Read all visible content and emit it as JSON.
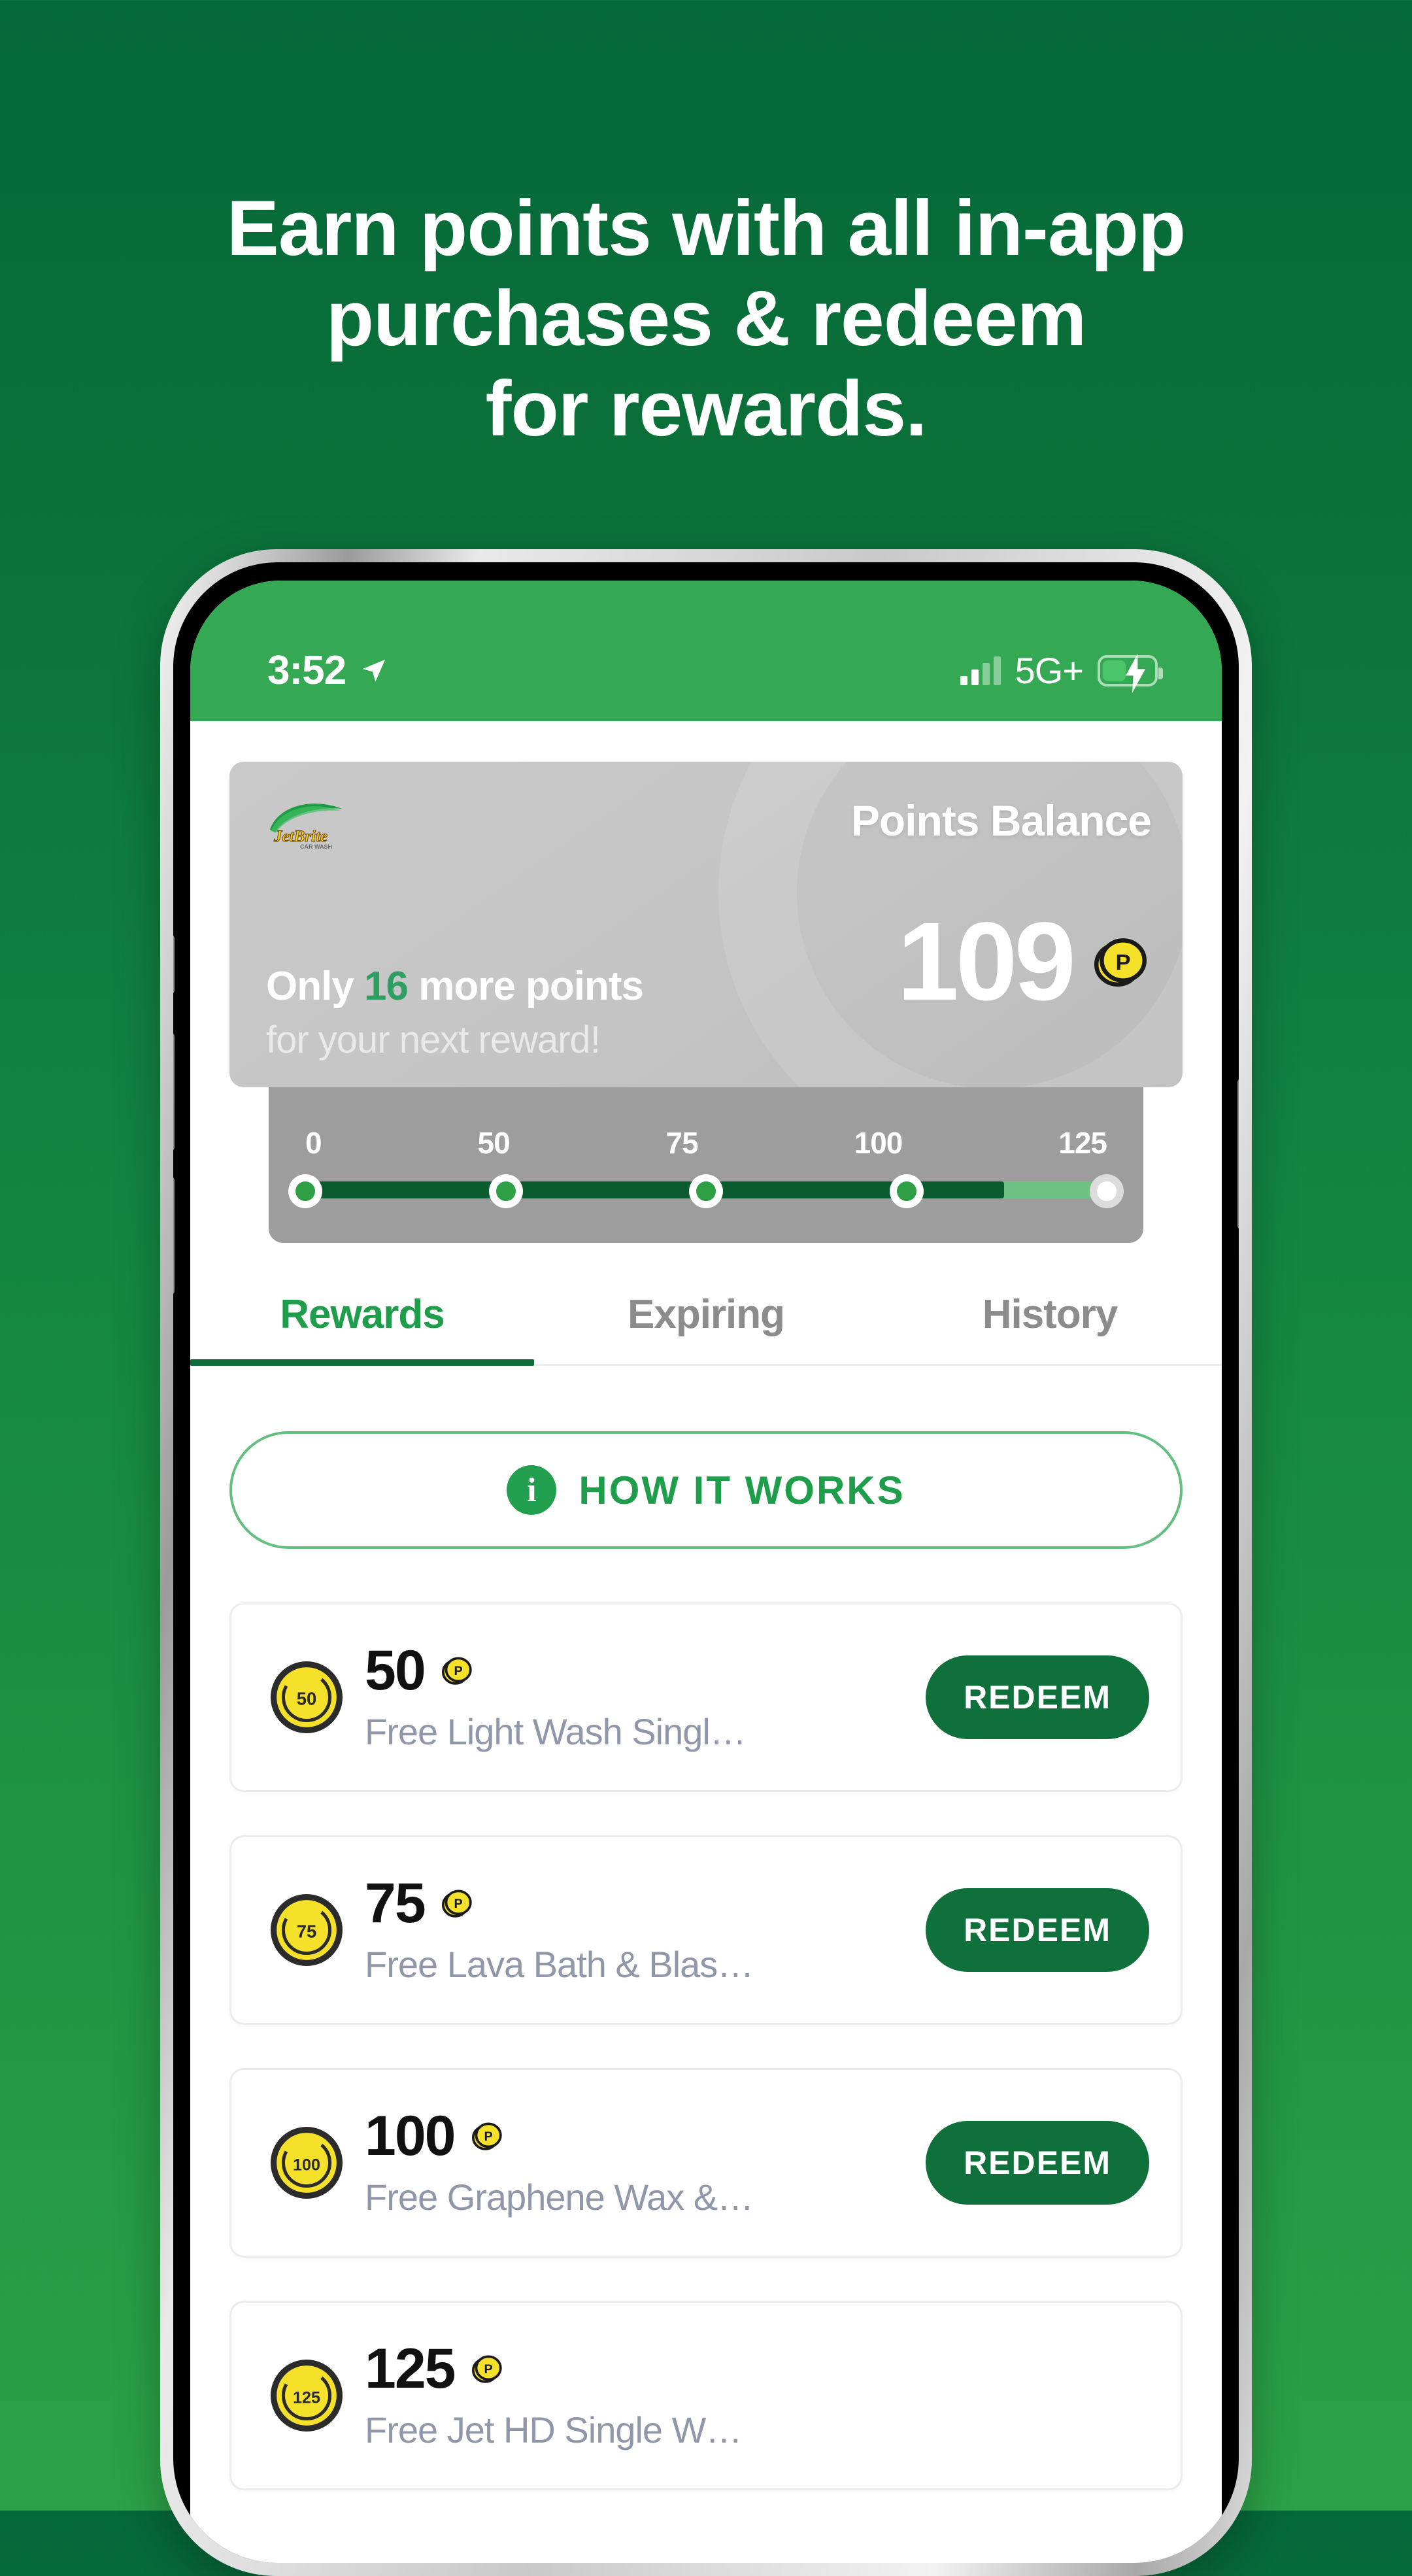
{
  "headline": {
    "line1": "Earn points with all in-app",
    "line2": "purchases & redeem",
    "line3": "for rewards."
  },
  "status_bar": {
    "time": "3:52",
    "location_icon": "location-arrow-icon",
    "signal_icon": "signal-bars-icon",
    "network": "5G+",
    "battery_icon": "battery-charging-icon"
  },
  "points_card": {
    "brand_logo": "jetbrite-car-wash-logo",
    "brand_name": "JetBrite",
    "brand_sub": "CAR WASH",
    "balance_label": "Points Balance",
    "balance_value": "109",
    "coin_icon": "points-coin-icon",
    "only_prefix": "Only ",
    "only_points": "16",
    "only_suffix": " more points",
    "next_reward_line": "for your next reward!",
    "accent_color": "#2E9E63"
  },
  "progress": {
    "ticks": [
      "0",
      "50",
      "75",
      "100",
      "125"
    ],
    "min": 0,
    "max": 125,
    "current": 109,
    "fill_color": "#0A5C2E",
    "remaining_color": "#6FC083"
  },
  "tabs": [
    {
      "label": "Rewards",
      "active": true
    },
    {
      "label": "Expiring",
      "active": false
    },
    {
      "label": "History",
      "active": false
    }
  ],
  "how_it_works": {
    "icon": "info-circle-icon",
    "label": "HOW IT WORKS"
  },
  "rewards": [
    {
      "badge": "50",
      "points": "50",
      "coin_icon": "points-coin-icon",
      "description": "Free Light Wash Singl…",
      "action": "REDEEM"
    },
    {
      "badge": "75",
      "points": "75",
      "coin_icon": "points-coin-icon",
      "description": "Free Lava Bath & Blas…",
      "action": "REDEEM"
    },
    {
      "badge": "100",
      "points": "100",
      "coin_icon": "points-coin-icon",
      "description": "Free Graphene Wax &…",
      "action": "REDEEM"
    },
    {
      "badge": "125",
      "points": "125",
      "coin_icon": "points-coin-icon",
      "description": "Free Jet HD Single W…",
      "action": ""
    }
  ],
  "colors": {
    "bg_top": "#05683A",
    "bg_bottom": "#2CA147",
    "status_green": "#34A853",
    "tab_active": "#1E9E4A",
    "redeem": "#10703B",
    "coin_yellow": "#F5E02A"
  }
}
